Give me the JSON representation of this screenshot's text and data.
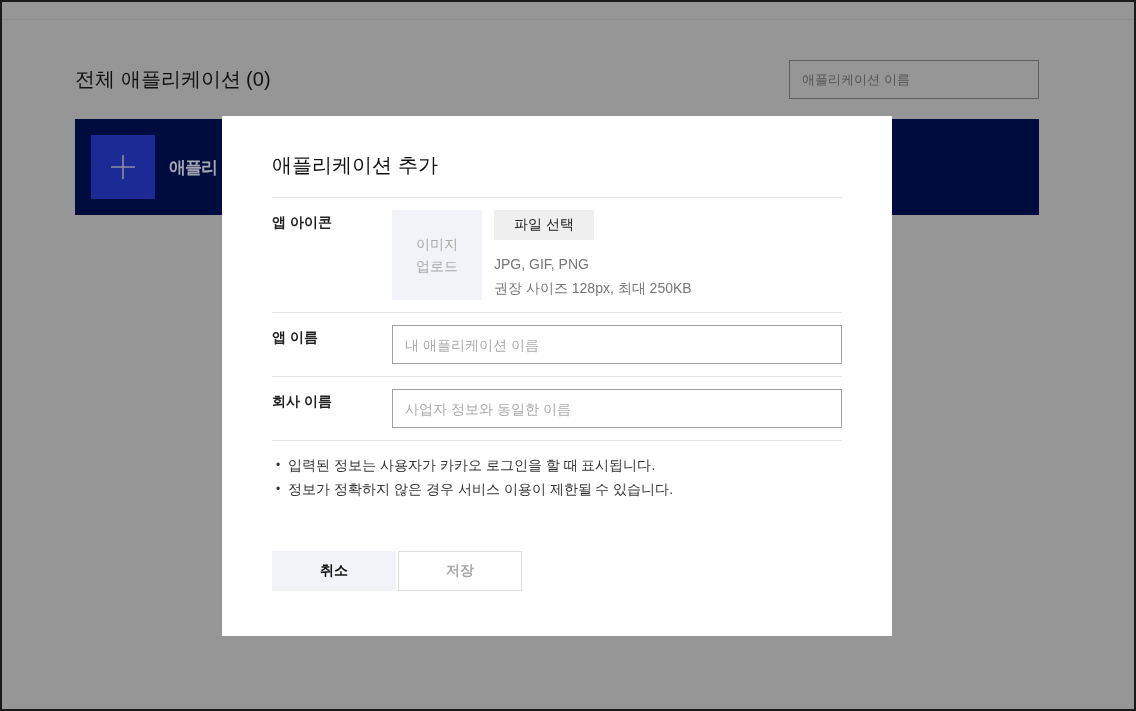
{
  "page": {
    "heading": "전체 애플리케이션 (0)",
    "search": {
      "placeholder": "애플리케이션 이름"
    },
    "banner": {
      "label": "애플리"
    }
  },
  "modal": {
    "title": "애플리케이션 추가",
    "fields": [
      {
        "kind": "icon",
        "label": "앱 아이콘",
        "upload": "이미지 업로드",
        "button": "파일 선택",
        "hints": [
          "JPG, GIF, PNG",
          "권장 사이즈 128px, 최대 250KB"
        ]
      },
      {
        "kind": "text",
        "label": "앱 이름",
        "placeholder": "내 애플리케이션 이름"
      },
      {
        "kind": "text",
        "label": "회사 이름",
        "placeholder": "사업자 정보와 동일한 이름"
      }
    ],
    "notes": [
      {
        "bullet": "•",
        "text": "입력된 정보는 사용자가 카카오 로그인을 할 때 표시됩니다."
      },
      {
        "bullet": "•",
        "text": "정보가 정확하지 않은 경우 서비스 이용이 제한될 수 있습니다."
      }
    ],
    "buttons": [
      {
        "label": "취소",
        "kind": "cancel",
        "disabled": false
      },
      {
        "label": "저장",
        "kind": "save",
        "disabled": true
      }
    ]
  }
}
